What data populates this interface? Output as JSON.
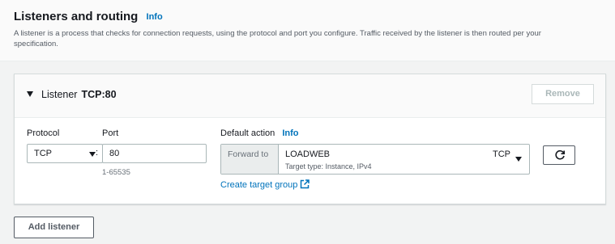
{
  "section": {
    "title": "Listeners and routing",
    "info": "Info",
    "description": "A listener is a process that checks for connection requests, using the protocol and port you configure. Traffic received by the listener is then routed per your specification."
  },
  "listener": {
    "label": "Listener",
    "name": "TCP:80",
    "remove_label": "Remove",
    "protocol": {
      "label": "Protocol",
      "value": "TCP"
    },
    "port": {
      "label": "Port",
      "value": "80",
      "hint": "1-65535",
      "separator": ":"
    },
    "default_action": {
      "label": "Default action",
      "info": "Info",
      "prefix": "Forward to",
      "target_group": "LOADWEB",
      "target_type": "Target type: Instance, IPv4",
      "protocol": "TCP"
    },
    "create_link": "Create target group"
  },
  "footer": {
    "add_listener_label": "Add listener"
  },
  "icons": {
    "expand": "caret-down-icon",
    "dropdown": "triangle-down-icon",
    "refresh": "refresh-icon",
    "external": "external-link-icon"
  },
  "colors": {
    "link": "#0073bb",
    "text": "#16191f",
    "muted": "#687078",
    "border": "#aab7b8",
    "disabled": "#aab7b8"
  }
}
